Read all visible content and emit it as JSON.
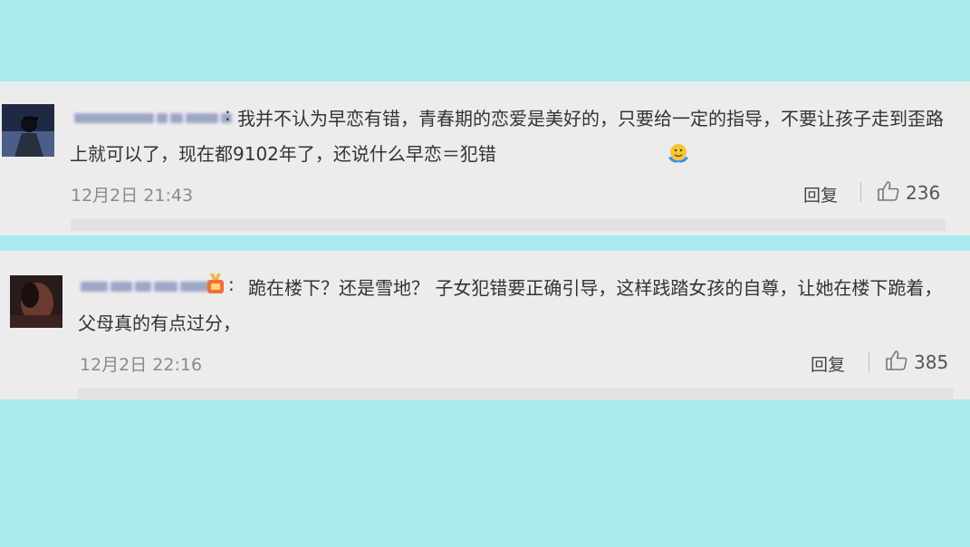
{
  "comments": [
    {
      "text": "我并不认为早恋有错，青春期的恋爱是美好的，只要给一定的指导，不要让孩子走到歪路上就可以了，现在都9102年了，还说什么早恋＝犯错",
      "colon": ":",
      "time": "12月2日 21:43",
      "reply_label": "回复",
      "likes": "236",
      "emoji": "shrug-face-icon"
    },
    {
      "text": "跪在楼下？还是雪地？ 子女犯错要正确引导，这样践踏女孩的自尊，让她在楼下跪着，父母真的有点过分，",
      "colon": ":",
      "time": "12月2日 22:16",
      "reply_label": "回复",
      "likes": "385"
    }
  ],
  "colors": {
    "background": "#a9ebea",
    "card": "#ececec",
    "text": "#333333",
    "meta": "#8a8a8a"
  }
}
